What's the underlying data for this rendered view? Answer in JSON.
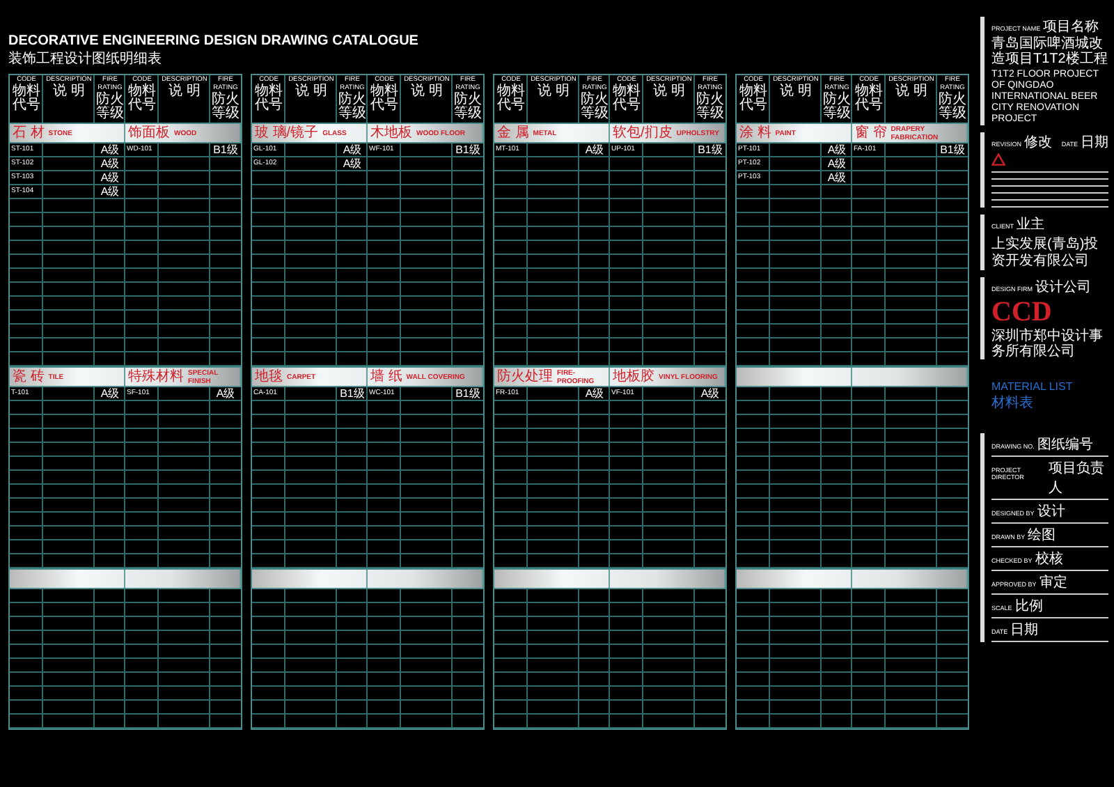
{
  "title": "DECORATIVE ENGINEERING DESIGN DRAWING CATALOGUE",
  "subtitle": "装饰工程设计图纸明细表",
  "panels": [
    {
      "column_groups": [
        [
          {
            "en": "CODE",
            "zh": "物料代号"
          },
          {
            "en": "DESCRIPTION",
            "zh": "说 明"
          },
          {
            "en": "FIRE RATING",
            "zh": "防火等级"
          }
        ],
        [
          {
            "en": "CODE",
            "zh": "物料代号"
          },
          {
            "en": "DESCRIPTION",
            "zh": "说 明"
          },
          {
            "en": "FIRE RATING",
            "zh": "防火等级"
          }
        ]
      ],
      "sections": [
        {
          "categories": [
            {
              "zh": "石 材",
              "en": "STONE",
              "rows": [
                {
                  "code": "ST-101",
                  "rating": "A级"
                },
                {
                  "code": "ST-102",
                  "rating": "A级"
                },
                {
                  "code": "ST-103",
                  "rating": "A级"
                },
                {
                  "code": "ST-104",
                  "rating": "A级"
                }
              ]
            },
            {
              "zh": "饰面板",
              "en": "WOOD",
              "rows": [
                {
                  "code": "WD-101",
                  "rating": "B1级"
                }
              ]
            }
          ]
        },
        {
          "categories": [
            {
              "zh": "瓷 砖",
              "en": "TILE",
              "rows": [
                {
                  "code": "T-101",
                  "rating": "A级"
                }
              ]
            },
            {
              "zh": "特殊材料",
              "en": "SPECIAL FINISH",
              "rows": [
                {
                  "code": "SF-101",
                  "rating": "A级"
                }
              ]
            }
          ]
        }
      ]
    },
    {
      "column_groups": [
        [
          {
            "en": "CODE",
            "zh": "物料代号"
          },
          {
            "en": "DESCRIPTION",
            "zh": "说 明"
          },
          {
            "en": "FIRE RATING",
            "zh": "防火等级"
          }
        ],
        [
          {
            "en": "CODE",
            "zh": "物料代号"
          },
          {
            "en": "DESCRIPTION",
            "zh": "说 明"
          },
          {
            "en": "FIRE RATING",
            "zh": "防火等级"
          }
        ]
      ],
      "sections": [
        {
          "categories": [
            {
              "zh": "玻 璃/镜子",
              "en": "GLASS",
              "rows": [
                {
                  "code": "GL-101",
                  "rating": "A级"
                },
                {
                  "code": "GL-102",
                  "rating": "A级"
                }
              ]
            },
            {
              "zh": "木地板",
              "en": "WOOD FLOOR",
              "rows": [
                {
                  "code": "WF-101",
                  "rating": "B1级"
                }
              ]
            }
          ]
        },
        {
          "categories": [
            {
              "zh": "地毯",
              "en": "CARPET",
              "rows": [
                {
                  "code": "CA-101",
                  "rating": "B1级"
                }
              ]
            },
            {
              "zh": "墙 纸",
              "en": "WALL COVERING",
              "rows": [
                {
                  "code": "WC-101",
                  "rating": "B1级"
                }
              ]
            }
          ]
        }
      ]
    },
    {
      "column_groups": [
        [
          {
            "en": "CODE",
            "zh": "物料代号"
          },
          {
            "en": "DESCRIPTION",
            "zh": "说 明"
          },
          {
            "en": "FIRE RATING",
            "zh": "防火等级"
          }
        ],
        [
          {
            "en": "CODE",
            "zh": "物料代号"
          },
          {
            "en": "DESCRIPTION",
            "zh": "说 明"
          },
          {
            "en": "FIRE RATING",
            "zh": "防火等级"
          }
        ]
      ],
      "sections": [
        {
          "categories": [
            {
              "zh": "金 属",
              "en": "METAL",
              "rows": [
                {
                  "code": "MT-101",
                  "rating": "A级"
                }
              ]
            },
            {
              "zh": "软包/扪皮",
              "en": "UPHOLSTRY",
              "rows": [
                {
                  "code": "UP-101",
                  "rating": "B1级"
                }
              ]
            }
          ]
        },
        {
          "categories": [
            {
              "zh": "防火处理",
              "en": "FIRE-PROOFING",
              "rows": [
                {
                  "code": "FR-101",
                  "rating": "A级"
                }
              ]
            },
            {
              "zh": "地板胶",
              "en": "VINYL FLOORING",
              "rows": [
                {
                  "code": "VF-101",
                  "rating": "A级"
                }
              ]
            }
          ]
        }
      ]
    },
    {
      "column_groups": [
        [
          {
            "en": "CODE",
            "zh": "物料代号"
          },
          {
            "en": "DESCRIPTION",
            "zh": "说 明"
          },
          {
            "en": "FIRE RATING",
            "zh": "防火等级"
          }
        ],
        [
          {
            "en": "CODE",
            "zh": "物料代号"
          },
          {
            "en": "DESCRIPTION",
            "zh": "说 明"
          },
          {
            "en": "FIRE RATING",
            "zh": "防火等级"
          }
        ]
      ],
      "sections": [
        {
          "categories": [
            {
              "zh": "涂 料",
              "en": "PAINT",
              "rows": [
                {
                  "code": "PT-101",
                  "rating": "A级"
                },
                {
                  "code": "PT-102",
                  "rating": "A级"
                },
                {
                  "code": "PT-103",
                  "rating": "A级"
                }
              ]
            },
            {
              "zh": "窗 帘",
              "en": "DRAPERY FABRICATION",
              "rows": [
                {
                  "code": "FA-101",
                  "rating": "B1级"
                }
              ]
            }
          ]
        }
      ]
    }
  ],
  "sidebar": {
    "project_label": {
      "en": "PROJECT NAME",
      "zh": "项目名称"
    },
    "project_name_zh": "青岛国际啤酒城改造项目T1T2楼工程",
    "project_name_en": "T1T2 FLOOR PROJECT OF QINGDAO INTERNATIONAL BEER CITY RENOVATION PROJECT",
    "revision_label": {
      "en": "REVISION",
      "zh": "修改"
    },
    "date_label": {
      "en": "DATE",
      "zh": "日期"
    },
    "client_label": {
      "en": "CLIENT",
      "zh": "业主"
    },
    "client_name": "上实发展(青岛)投资开发有限公司",
    "design_firm_label": {
      "en": "DESIGN FIRM",
      "zh": "设计公司"
    },
    "logo": "CCD",
    "design_firm_name": "深圳市郑中设计事务所有限公司",
    "drawing_title_en": "MATERIAL LIST",
    "drawing_title_zh": "材料表",
    "fields": [
      {
        "en": "DRAWING NO.",
        "zh": "图纸编号"
      },
      {
        "en": "PROJECT DIRECTOR",
        "zh": "项目负责人"
      },
      {
        "en": "DESIGNED BY",
        "zh": "设计"
      },
      {
        "en": "DRAWN BY",
        "zh": "绘图"
      },
      {
        "en": "CHECKED BY",
        "zh": "校核"
      },
      {
        "en": "APPROVED BY",
        "zh": "审定"
      },
      {
        "en": "SCALE",
        "zh": "比例"
      },
      {
        "en": "DATE",
        "zh": "日期"
      }
    ]
  }
}
